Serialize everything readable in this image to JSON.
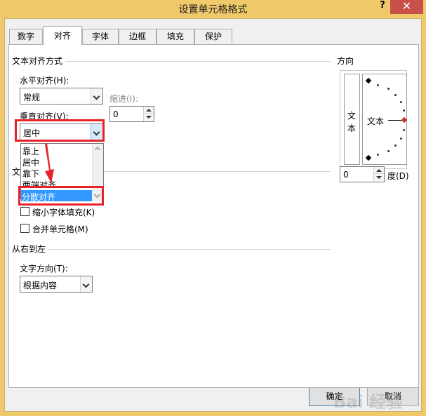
{
  "window": {
    "title": "设置单元格格式",
    "help": "?",
    "close": "✕"
  },
  "tabs": [
    {
      "label": "数字"
    },
    {
      "label": "对齐"
    },
    {
      "label": "字体"
    },
    {
      "label": "边框"
    },
    {
      "label": "填充"
    },
    {
      "label": "保护"
    }
  ],
  "active_tab": "对齐",
  "text_alignment": {
    "group_label": "文本对齐方式",
    "horizontal_label": "水平对齐(H):",
    "horizontal_value": "常规",
    "indent_label": "缩进(I):",
    "indent_value": "0",
    "vertical_label": "垂直对齐(V):",
    "vertical_value": "居中",
    "vertical_options": [
      "靠上",
      "居中",
      "靠下",
      "两端对齐",
      "分散对齐"
    ],
    "vertical_highlighted": "分散对齐"
  },
  "text_control": {
    "group_label": "文",
    "shrink_to_fit": "缩小字体填充(K)",
    "merge_cells": "合并单元格(M)"
  },
  "rtl": {
    "group_label": "从右到左",
    "direction_label": "文字方向(T):",
    "direction_value": "根据内容"
  },
  "orientation": {
    "group_label": "方向",
    "vertical_text": [
      "文",
      "本"
    ],
    "dial_text": "文本",
    "degree_value": "0",
    "degree_label": "度(D)"
  },
  "buttons": {
    "ok": "确定",
    "cancel": "取消"
  },
  "watermark": "Bai 经验",
  "colors": {
    "title_bar": "#f0c96a",
    "highlight": "#3399ff",
    "annotation": "#e8212a",
    "close": "#c7504a"
  }
}
